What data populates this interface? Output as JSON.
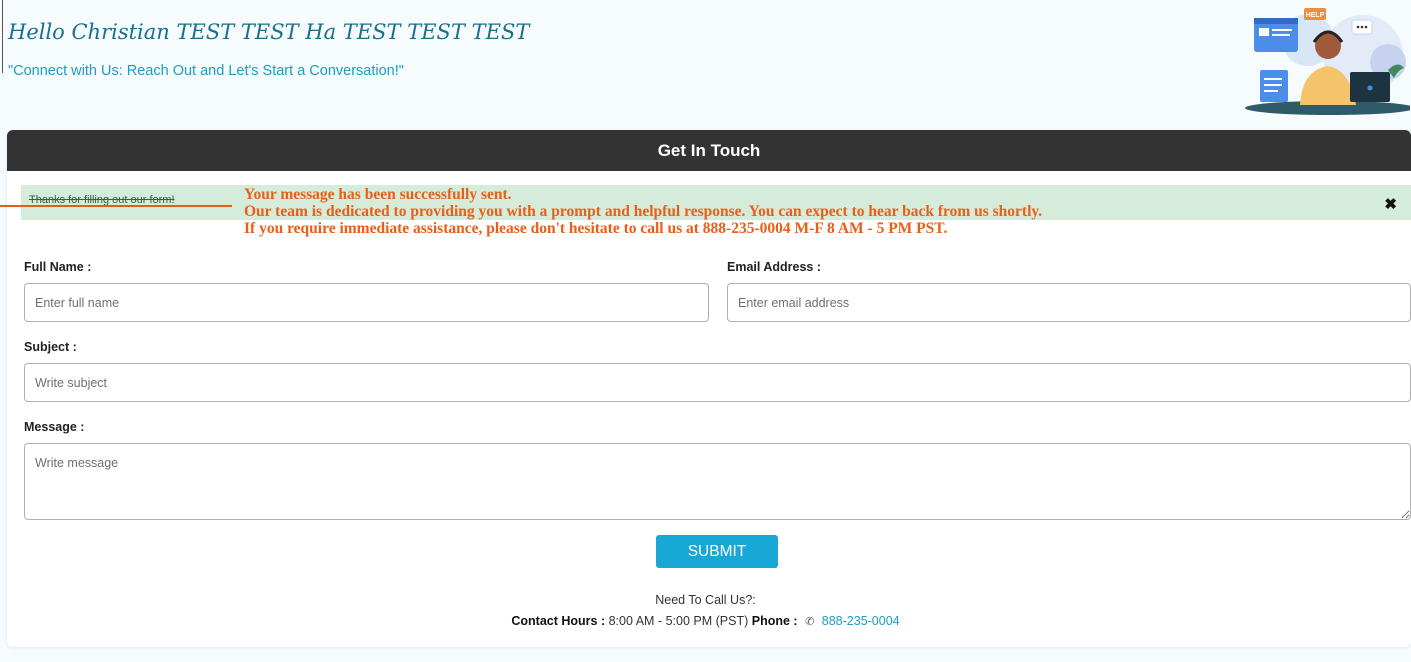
{
  "header": {
    "greeting": "Hello Christian TEST TEST Ha TEST TEST TEST",
    "tagline": "\"Connect with Us: Reach Out and Let's Start a Conversation!\"",
    "illustration_badge": "HELP"
  },
  "card": {
    "title": "Get In Touch"
  },
  "alert": {
    "text": "Thanks for filling out our form!",
    "close_icon": "close-icon"
  },
  "overlay_message": {
    "line1": "Your message has been successfully sent.",
    "line2": "Our team is dedicated to providing you with a prompt and helpful response. You can expect to hear back from us shortly.",
    "line3": "If you require immediate assistance, please don't hesitate to call us at 888-235-0004 M-F 8 AM - 5 PM PST.",
    "color": "#ec5d17"
  },
  "form": {
    "full_name": {
      "label": "Full Name :",
      "placeholder": "Enter full name",
      "value": ""
    },
    "email": {
      "label": "Email Address :",
      "placeholder": "Enter email address",
      "value": ""
    },
    "subject": {
      "label": "Subject :",
      "placeholder": "Write subject",
      "value": ""
    },
    "message": {
      "label": "Message :",
      "placeholder": "Write message",
      "value": ""
    },
    "submit_label": "SUBMIT"
  },
  "footer": {
    "need_call": "Need To Call Us?:",
    "hours_label": "Contact Hours :",
    "hours_value": "8:00 AM - 5:00 PM (PST)",
    "phone_label": "Phone :",
    "phone_icon": "phone-icon",
    "phone_number": "888-235-0004"
  },
  "colors": {
    "accent": "#18a8d6",
    "header_bar": "#333333",
    "alert_bg": "#d4ecd9",
    "greeting": "#18708a"
  }
}
